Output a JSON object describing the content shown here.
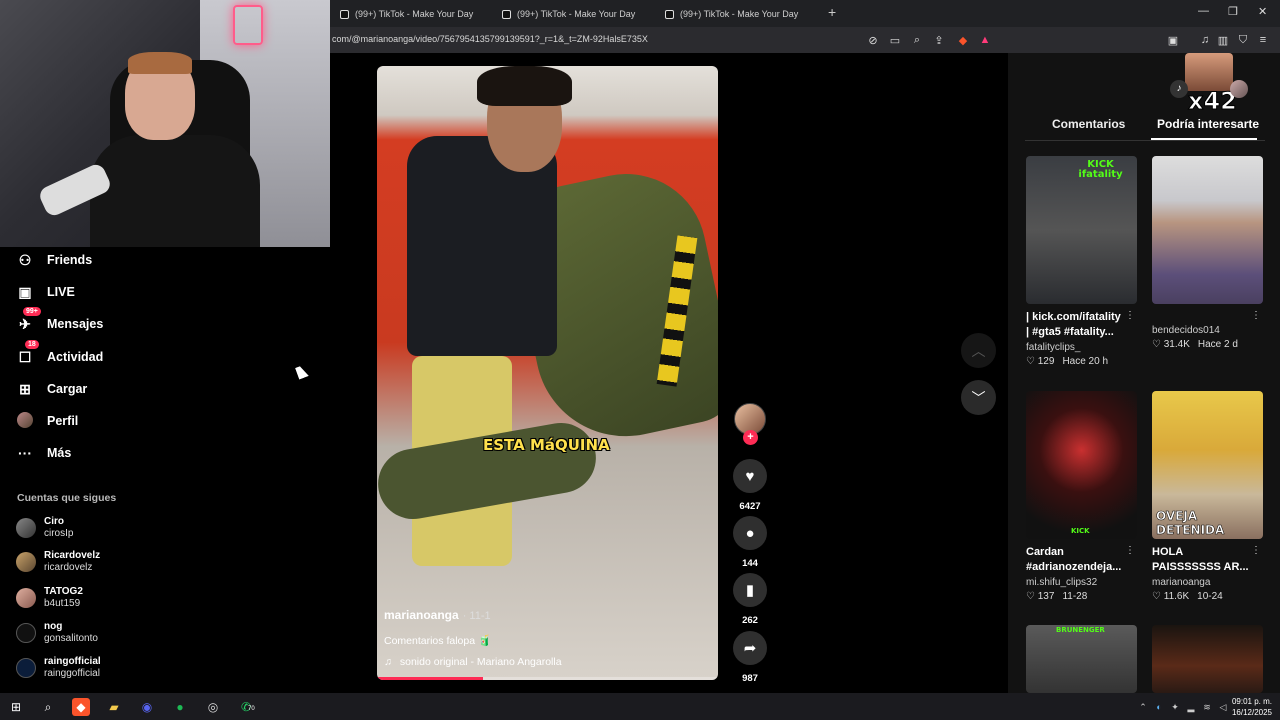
{
  "browser": {
    "tabs": [
      {
        "title": "(99+) TikTok - Make Your Day"
      },
      {
        "title": "(99+) TikTok - Make Your Day"
      },
      {
        "title": "(99+) TikTok - Make Your Day"
      }
    ],
    "new_tab": "+",
    "url": "com/@marianoanga/video/7567954135799139591?_r=1&_t=ZM-92HalsE735X"
  },
  "sidebar": {
    "items": [
      {
        "label": "Friends",
        "icon": "friends-icon"
      },
      {
        "label": "LIVE",
        "icon": "live-icon"
      },
      {
        "label": "Mensajes",
        "icon": "messages-icon",
        "badge": "99+"
      },
      {
        "label": "Actividad",
        "icon": "activity-icon",
        "badge": "18"
      },
      {
        "label": "Cargar",
        "icon": "upload-icon"
      },
      {
        "label": "Perfil",
        "icon": "profile-icon"
      },
      {
        "label": "Más",
        "icon": "more-icon"
      }
    ],
    "following_title": "Cuentas que sigues",
    "following": [
      {
        "name": "Ciro",
        "handle": "cirosIp"
      },
      {
        "name": "Ricardovelz",
        "handle": "ricardovelz"
      },
      {
        "name": "TATOG2",
        "handle": "b4ut159"
      },
      {
        "name": "nog",
        "handle": "gonsalitonto"
      },
      {
        "name": "raingofficial",
        "handle": "rainggofficial"
      }
    ]
  },
  "video": {
    "caption_overlay": "ESTA MáQUINA",
    "author": "marianoanga",
    "date": "· 11-1",
    "description": "Comentarios falopa 🧃",
    "sound": "sonido original - Mariano Angarolla",
    "progress": 0.31
  },
  "actions": {
    "likes": "6427",
    "comments": "144",
    "saves": "262",
    "shares": "987"
  },
  "right_panel": {
    "overlay_text": "x42",
    "tabs": [
      "Comentarios",
      "Podría interesarte"
    ],
    "active_tab": "Podría interesarte",
    "cards": [
      {
        "title": "| kick.com/ifatality | #gta5 #fatality...",
        "author": "fatalityclips_",
        "likes": "129",
        "time": "Hace 20 h",
        "thumb_text": "KICK ifatality"
      },
      {
        "title": "",
        "author": "bendecidos014",
        "likes": "31.4K",
        "time": "Hace 2 d",
        "thumb_text": ""
      },
      {
        "title": "Cardan #adrianozendeja...",
        "author": "mi.shifu_clips32",
        "likes": "137",
        "time": "11-28",
        "thumb_text": "KICK"
      },
      {
        "title": "HOLA PAISSSSSSS AR...",
        "author": "marianoanga",
        "likes": "11.6K",
        "time": "10-24",
        "thumb_text": "OVEJA DETENIDA"
      },
      {
        "title": "",
        "author": "",
        "likes": "",
        "time": "",
        "thumb_text": "BRUNENGER"
      },
      {
        "title": "",
        "author": "",
        "likes": "",
        "time": "",
        "thumb_text": ""
      }
    ]
  },
  "taskbar": {
    "time": "09:01 p. m.",
    "date": "16/12/2025",
    "whatsapp_badge": "70"
  }
}
